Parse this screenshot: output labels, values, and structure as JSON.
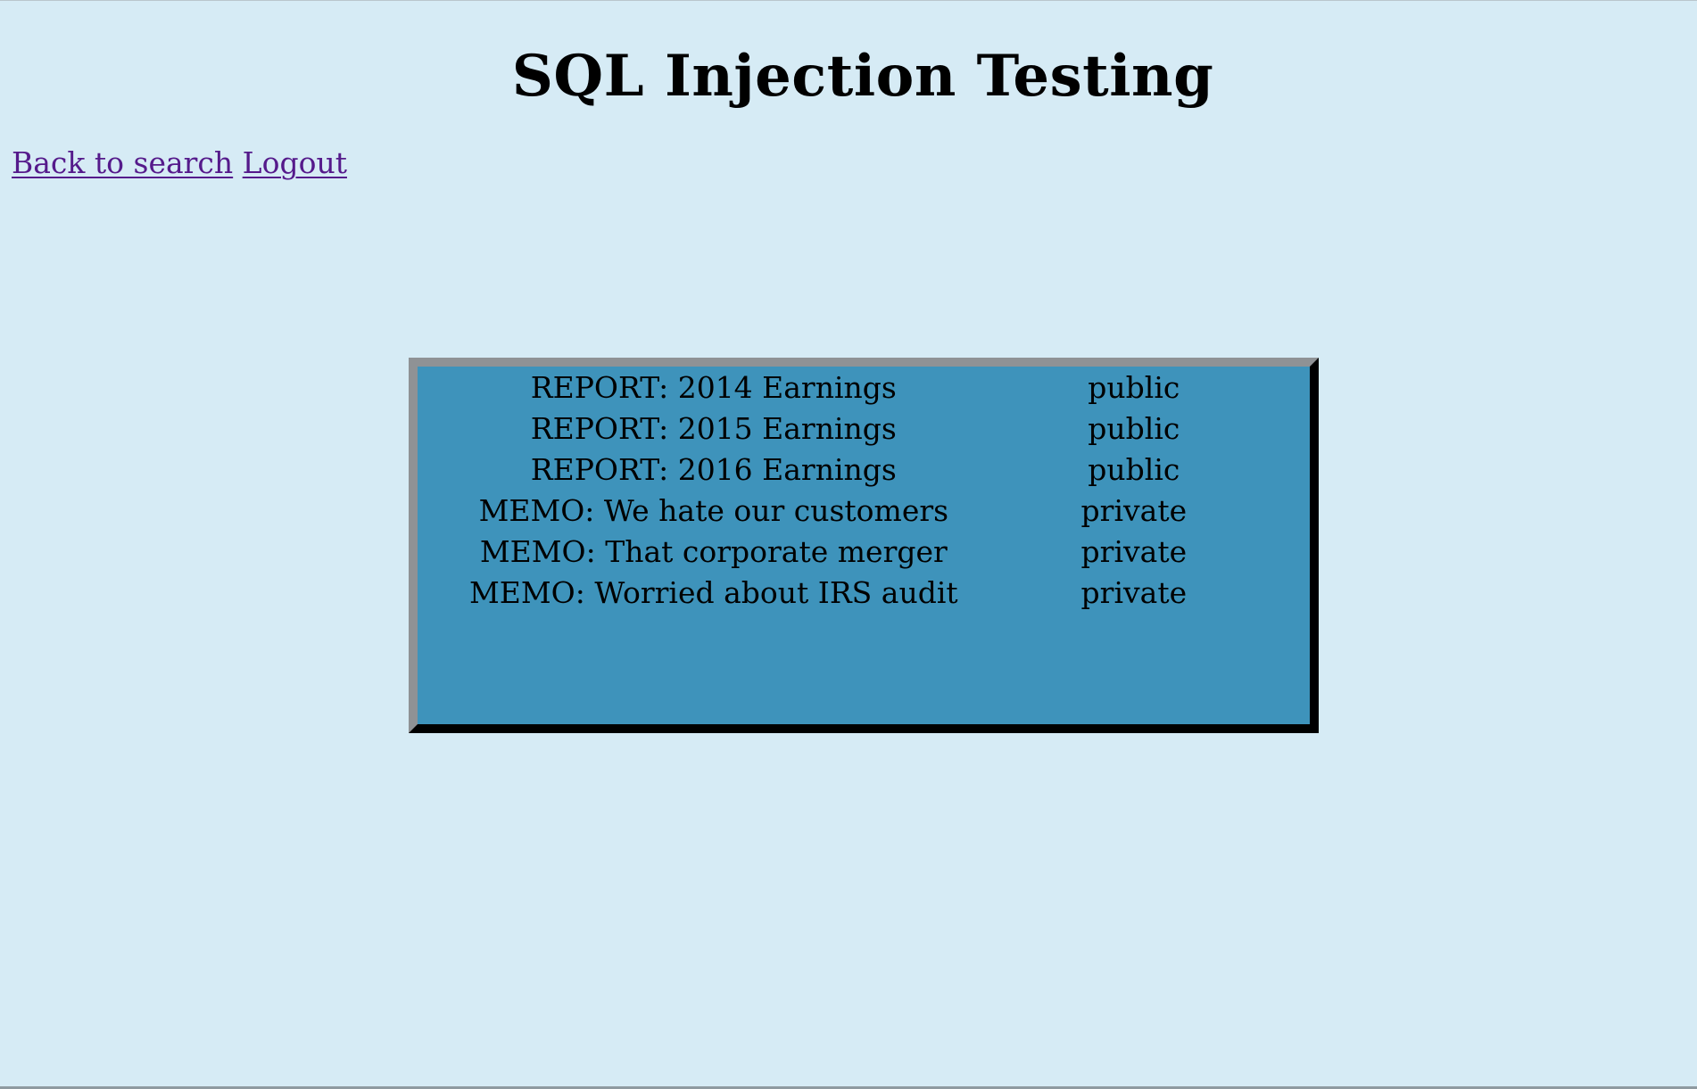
{
  "page": {
    "title": "SQL Injection Testing"
  },
  "nav": {
    "back_to_search": "Back to search",
    "logout": "Logout"
  },
  "results": {
    "rows": [
      {
        "title": "REPORT: 2014 Earnings",
        "visibility": "public"
      },
      {
        "title": "REPORT: 2015 Earnings",
        "visibility": "public"
      },
      {
        "title": "REPORT: 2016 Earnings",
        "visibility": "public"
      },
      {
        "title": "MEMO: We hate our customers",
        "visibility": "private"
      },
      {
        "title": "MEMO: That corporate merger",
        "visibility": "private"
      },
      {
        "title": "MEMO: Worried about IRS audit",
        "visibility": "private"
      }
    ]
  },
  "colors": {
    "background": "#d6ebf5",
    "results_panel": "#3e93bb",
    "link": "#551a8b"
  }
}
